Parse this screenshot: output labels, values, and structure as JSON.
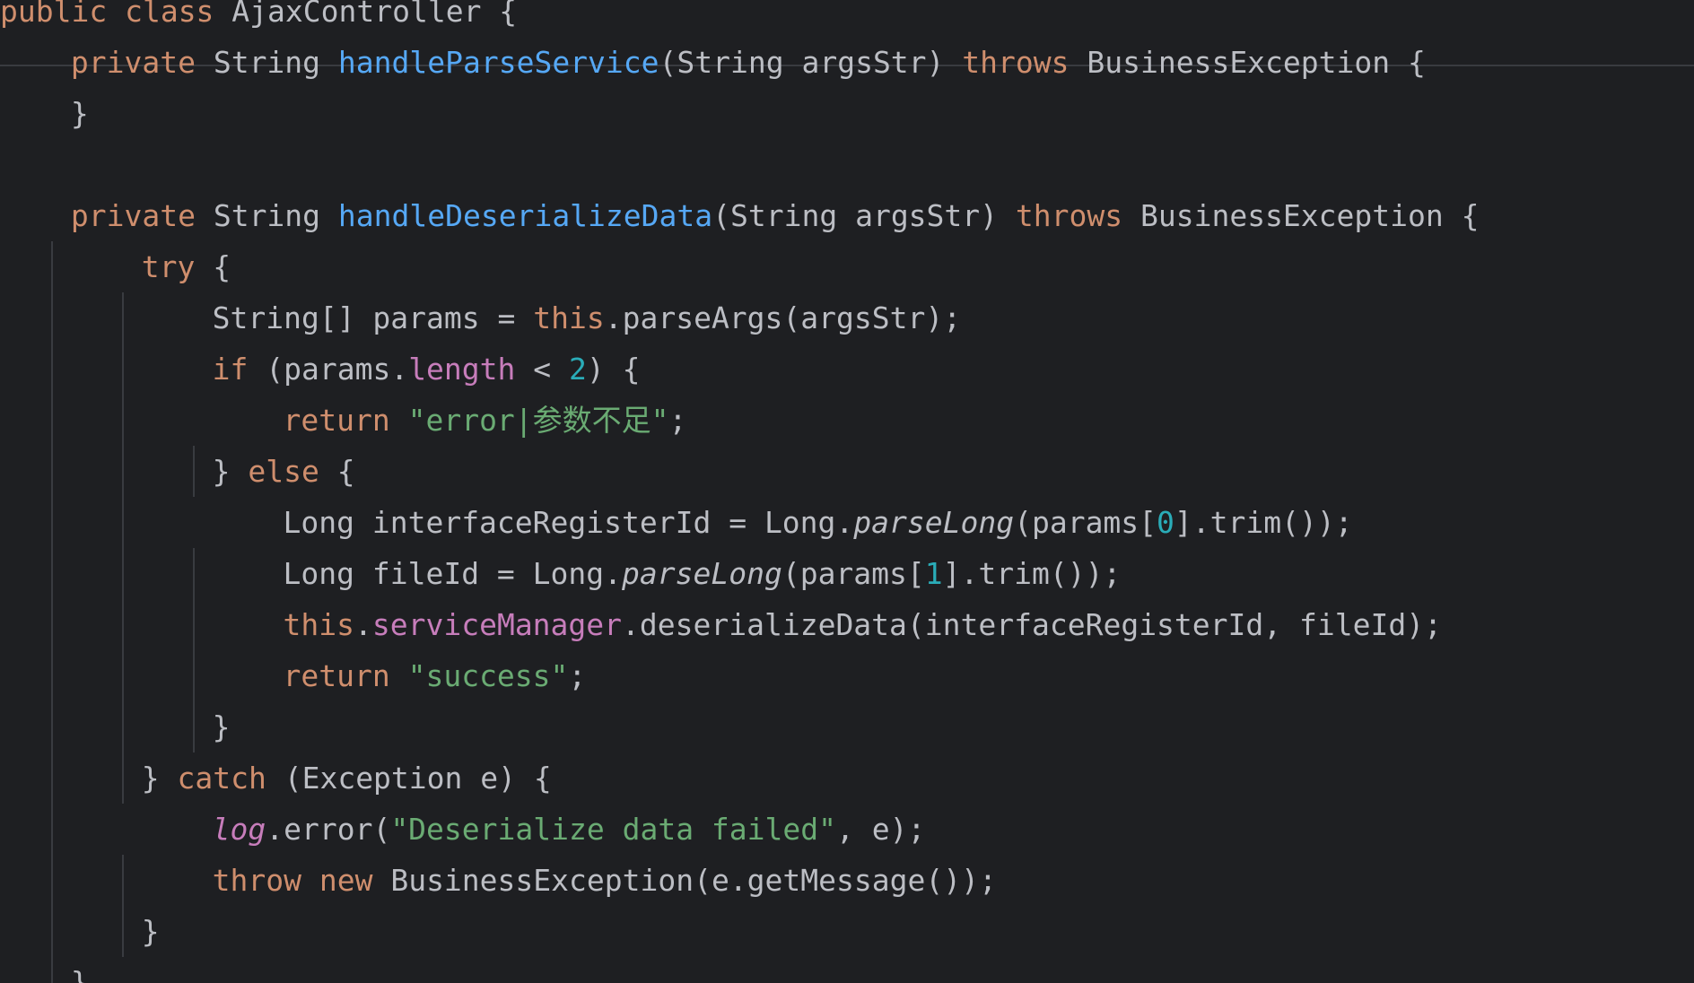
{
  "editor": {
    "theme": {
      "background": "#1e1f22",
      "plain": "#bcbec4",
      "keyword": "#cf8e6d",
      "function": "#56a8f5",
      "string": "#6aab73",
      "number": "#2aacb8",
      "field": "#c77dbb",
      "guide": "#393b40"
    },
    "lines": [
      {
        "indent": 0,
        "tokens": [
          {
            "t": "public",
            "c": "kw"
          },
          {
            "t": " class ",
            "c": "kw"
          },
          {
            "t": "AjaxController {",
            "c": "plain"
          }
        ]
      },
      {
        "indent": 1,
        "tokens": [
          {
            "t": "private ",
            "c": "kw"
          },
          {
            "t": "String ",
            "c": "plain"
          },
          {
            "t": "handleParseService",
            "c": "fn"
          },
          {
            "t": "(String argsStr) ",
            "c": "plain"
          },
          {
            "t": "throws ",
            "c": "kw"
          },
          {
            "t": "BusinessException {",
            "c": "plain"
          }
        ]
      },
      {
        "indent": 1,
        "tokens": [
          {
            "t": "}",
            "c": "plain"
          }
        ]
      },
      {
        "indent": 0,
        "tokens": []
      },
      {
        "indent": 1,
        "tokens": [
          {
            "t": "private ",
            "c": "kw"
          },
          {
            "t": "String ",
            "c": "plain"
          },
          {
            "t": "handleDeserializeData",
            "c": "fn"
          },
          {
            "t": "(String argsStr) ",
            "c": "plain"
          },
          {
            "t": "throws ",
            "c": "kw"
          },
          {
            "t": "BusinessException {",
            "c": "plain"
          }
        ]
      },
      {
        "indent": 2,
        "tokens": [
          {
            "t": "try ",
            "c": "kw"
          },
          {
            "t": "{",
            "c": "plain"
          }
        ]
      },
      {
        "indent": 3,
        "tokens": [
          {
            "t": "String[] params = ",
            "c": "plain"
          },
          {
            "t": "this",
            "c": "kw"
          },
          {
            "t": ".parseArgs(argsStr);",
            "c": "plain"
          }
        ]
      },
      {
        "indent": 3,
        "tokens": [
          {
            "t": "if ",
            "c": "kw"
          },
          {
            "t": "(params.",
            "c": "plain"
          },
          {
            "t": "length",
            "c": "fld"
          },
          {
            "t": " < ",
            "c": "plain"
          },
          {
            "t": "2",
            "c": "num"
          },
          {
            "t": ") {",
            "c": "plain"
          }
        ]
      },
      {
        "indent": 4,
        "tokens": [
          {
            "t": "return ",
            "c": "kw"
          },
          {
            "t": "\"error|参数不足\"",
            "c": "str"
          },
          {
            "t": ";",
            "c": "plain"
          }
        ]
      },
      {
        "indent": 3,
        "tokens": [
          {
            "t": "} ",
            "c": "plain"
          },
          {
            "t": "else ",
            "c": "kw"
          },
          {
            "t": "{",
            "c": "plain"
          }
        ]
      },
      {
        "indent": 4,
        "tokens": [
          {
            "t": "Long interfaceRegisterId = Long.",
            "c": "plain"
          },
          {
            "t": "parseLong",
            "c": "plain it"
          },
          {
            "t": "(params[",
            "c": "plain"
          },
          {
            "t": "0",
            "c": "num"
          },
          {
            "t": "].trim());",
            "c": "plain"
          }
        ]
      },
      {
        "indent": 4,
        "tokens": [
          {
            "t": "Long fileId = Long.",
            "c": "plain"
          },
          {
            "t": "parseLong",
            "c": "plain it"
          },
          {
            "t": "(params[",
            "c": "plain"
          },
          {
            "t": "1",
            "c": "num"
          },
          {
            "t": "].trim());",
            "c": "plain"
          }
        ]
      },
      {
        "indent": 4,
        "tokens": [
          {
            "t": "this",
            "c": "kw"
          },
          {
            "t": ".",
            "c": "plain"
          },
          {
            "t": "serviceManager",
            "c": "fld"
          },
          {
            "t": ".deserializeData(interfaceRegisterId, fileId);",
            "c": "plain"
          }
        ]
      },
      {
        "indent": 4,
        "tokens": [
          {
            "t": "return ",
            "c": "kw"
          },
          {
            "t": "\"success\"",
            "c": "str"
          },
          {
            "t": ";",
            "c": "plain"
          }
        ]
      },
      {
        "indent": 3,
        "tokens": [
          {
            "t": "}",
            "c": "plain"
          }
        ]
      },
      {
        "indent": 2,
        "tokens": [
          {
            "t": "} ",
            "c": "plain"
          },
          {
            "t": "catch ",
            "c": "kw"
          },
          {
            "t": "(Exception e) {",
            "c": "plain"
          }
        ]
      },
      {
        "indent": 3,
        "tokens": [
          {
            "t": "log",
            "c": "fld it"
          },
          {
            "t": ".error(",
            "c": "plain"
          },
          {
            "t": "\"Deserialize data failed\"",
            "c": "str"
          },
          {
            "t": ", e);",
            "c": "plain"
          }
        ]
      },
      {
        "indent": 3,
        "tokens": [
          {
            "t": "throw ",
            "c": "kw"
          },
          {
            "t": "new ",
            "c": "kw"
          },
          {
            "t": "BusinessException(e.getMessage());",
            "c": "plain"
          }
        ]
      },
      {
        "indent": 2,
        "tokens": [
          {
            "t": "}",
            "c": "plain"
          }
        ]
      },
      {
        "indent": 1,
        "tokens": [
          {
            "t": "}",
            "c": "plain"
          }
        ]
      }
    ]
  }
}
